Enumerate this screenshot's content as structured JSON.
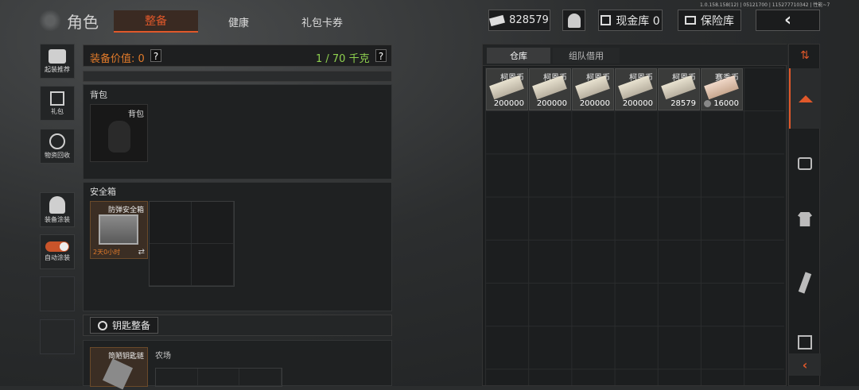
{
  "version": "1.0.158.158(12) | 05121700 | 115277710342 | 性能~7",
  "title": "角色",
  "tabs": [
    {
      "label": "整备",
      "active": true
    },
    {
      "label": "健康",
      "active": false
    },
    {
      "label": "礼包卡券",
      "active": false
    }
  ],
  "currency": {
    "amount": "828579"
  },
  "cash_vault": {
    "label": "现金库 0"
  },
  "insurance": {
    "label": "保险库"
  },
  "sidebar": [
    {
      "label": "起装推荐"
    },
    {
      "label": "礼包"
    },
    {
      "label": "物资回收"
    },
    {
      "label": "装备涂装"
    },
    {
      "label": "自动涂装"
    }
  ],
  "equip": {
    "value_label": "装备价值: 0",
    "weight": "1 / 70 千克",
    "help": "?"
  },
  "backpack": {
    "section": "背包",
    "slot_label": "背包"
  },
  "safebox": {
    "section": "安全箱",
    "item_name": "防弹安全箱",
    "timer": "2天0小时"
  },
  "keys": {
    "button": "钥匙整备",
    "item_name": "简陋钥匙链",
    "map": "农场"
  },
  "warehouse": {
    "tabs": [
      {
        "label": "仓库",
        "active": true
      },
      {
        "label": "组队借用",
        "active": false
      }
    ],
    "items": [
      {
        "name": "柯恩币",
        "count": "200000"
      },
      {
        "name": "柯恩币",
        "count": "200000"
      },
      {
        "name": "柯恩币",
        "count": "200000"
      },
      {
        "name": "柯恩币",
        "count": "200000"
      },
      {
        "name": "柯恩币",
        "count": "28579"
      },
      {
        "name": "赛季币",
        "count": "16000"
      }
    ]
  },
  "colors": {
    "accent": "#e0582a",
    "green": "#8fd14f",
    "orange": "#e07a2a"
  }
}
